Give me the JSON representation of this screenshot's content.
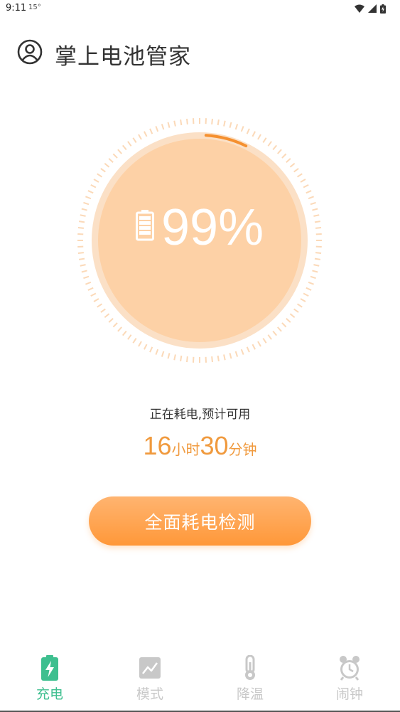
{
  "status_bar": {
    "time": "9:11",
    "extra": "15°"
  },
  "header": {
    "title": "掌上电池管家",
    "avatar_icon": "user-circle-icon"
  },
  "battery": {
    "percent_text": "99%",
    "level": 0.99,
    "icon": "battery-icon",
    "accent": "#f5902f"
  },
  "status": {
    "message": "正在耗电,预计可用",
    "hours": "16",
    "hours_unit": "小时",
    "minutes": "30",
    "minutes_unit": "分钟"
  },
  "action": {
    "label": "全面耗电检测"
  },
  "nav": {
    "items": [
      {
        "label": "充电",
        "icon": "battery-charge-icon",
        "active": true
      },
      {
        "label": "模式",
        "icon": "chart-mode-icon",
        "active": false
      },
      {
        "label": "降温",
        "icon": "thermometer-icon",
        "active": false
      },
      {
        "label": "闹钟",
        "icon": "alarm-clock-icon",
        "active": false
      }
    ]
  },
  "colors": {
    "active": "#3ebf8f",
    "inactive": "#c8c8c8",
    "orange": "#f09a3e",
    "circle": "#fdd1a6"
  }
}
